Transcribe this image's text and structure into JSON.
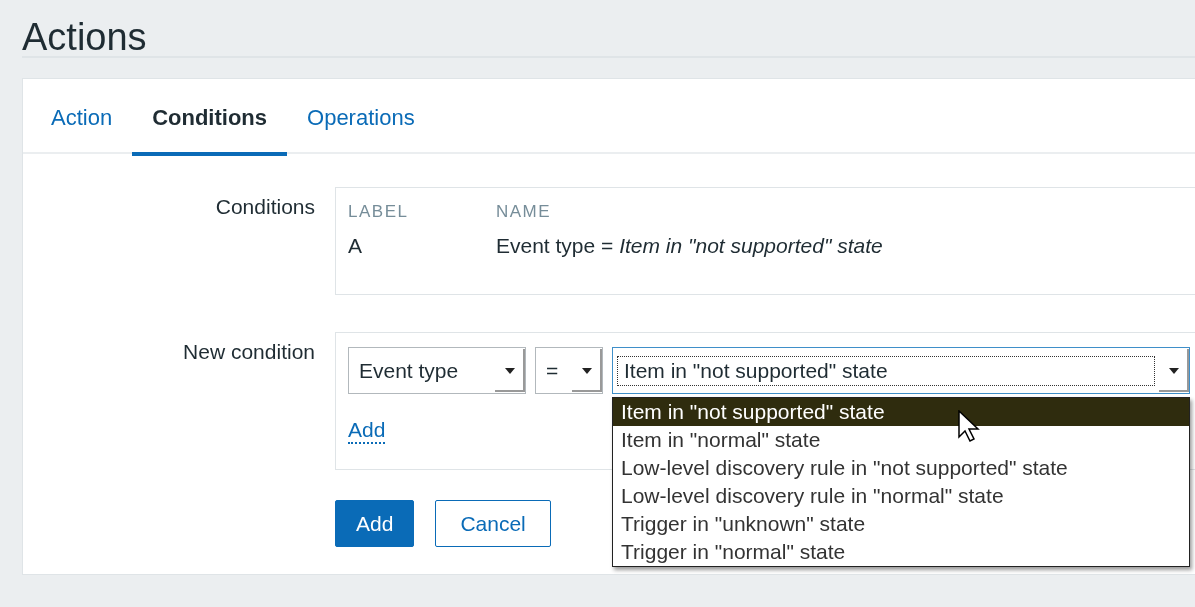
{
  "page": {
    "title": "Actions"
  },
  "tabs": [
    {
      "label": "Action",
      "selected": false
    },
    {
      "label": "Conditions",
      "selected": true
    },
    {
      "label": "Operations",
      "selected": false
    }
  ],
  "conditions": {
    "label": "Conditions",
    "columns": [
      "LABEL",
      "NAME"
    ],
    "rows": [
      {
        "label": "A",
        "name": "Event type = *Item in \"not supported\" state*"
      }
    ]
  },
  "new_condition": {
    "label": "New condition",
    "selects": [
      {
        "value": "Event type",
        "expanded": false
      },
      {
        "value": "=",
        "expanded": false
      },
      {
        "value": "Item in \"not supported\" state",
        "expanded": true,
        "options": [
          {
            "label": "Item in \"not supported\" state",
            "selected": true
          },
          {
            "label": "Item in \"normal\" state",
            "selected": false
          },
          {
            "label": "Low-level discovery rule in \"not supported\" state",
            "selected": false
          },
          {
            "label": "Low-level discovery rule in \"normal\" state",
            "selected": false
          },
          {
            "label": "Trigger in \"unknown\" state",
            "selected": false
          },
          {
            "label": "Trigger in \"normal\" state",
            "selected": false
          }
        ]
      }
    ],
    "add_link": "Add"
  },
  "buttons": [
    {
      "label": "Add",
      "kind": "primary"
    },
    {
      "label": "Cancel",
      "kind": "secondary"
    }
  ]
}
